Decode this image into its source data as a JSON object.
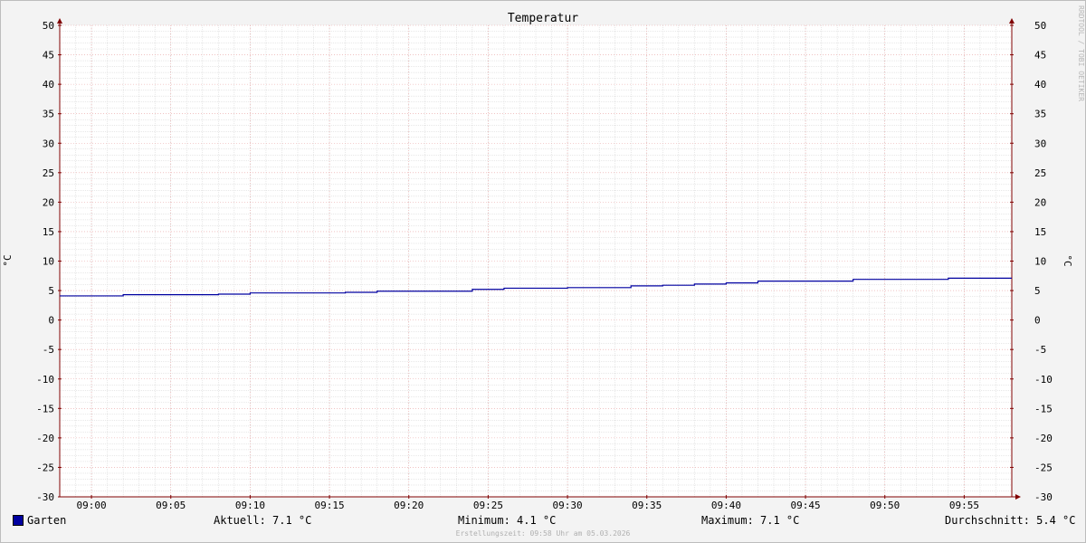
{
  "chart_data": {
    "type": "line",
    "title": "Temperatur",
    "ylabel": "°C",
    "ylim": [
      -30,
      50
    ],
    "y_ticks": [
      50,
      45,
      40,
      35,
      30,
      25,
      20,
      15,
      10,
      5,
      0,
      -5,
      -10,
      -15,
      -20,
      -25,
      -30
    ],
    "x_ticks": [
      "09:00",
      "09:05",
      "09:10",
      "09:15",
      "09:20",
      "09:25",
      "09:30",
      "09:35",
      "09:40",
      "09:45",
      "09:50",
      "09:55"
    ],
    "x_range": [
      "08:58",
      "09:58"
    ],
    "grid": true,
    "legend_position": "bottom-left",
    "series": [
      {
        "name": "Garten",
        "color": "#0000a0",
        "x": [
          "08:58",
          "09:02",
          "09:08",
          "09:10",
          "09:16",
          "09:18",
          "09:24",
          "09:26",
          "09:30",
          "09:34",
          "09:36",
          "09:38",
          "09:40",
          "09:42",
          "09:48",
          "09:54",
          "09:58"
        ],
        "values": [
          4.1,
          4.3,
          4.4,
          4.6,
          4.7,
          4.9,
          5.2,
          5.4,
          5.5,
          5.8,
          5.9,
          6.1,
          6.3,
          6.6,
          6.9,
          7.1,
          7.1
        ]
      }
    ]
  },
  "legend": {
    "series_label": "Garten",
    "aktuell": "Aktuell: 7.1 °C",
    "minimum": "Minimum: 4.1 °C",
    "maximum": "Maximum: 7.1 °C",
    "durchschnitt": "Durchschnitt: 5.4 °C"
  },
  "footer": "Erstellungszeit: 09:58 Uhr am 05.03.2026",
  "watermark": "RRDTOOL / TOBI OETIKER",
  "colors": {
    "background": "#f3f3f3",
    "plot_background": "#ffffff",
    "major_grid": "#e8a0a0",
    "minor_grid": "#d0d0d0",
    "axis": "#800000",
    "series": "#0000a0"
  }
}
